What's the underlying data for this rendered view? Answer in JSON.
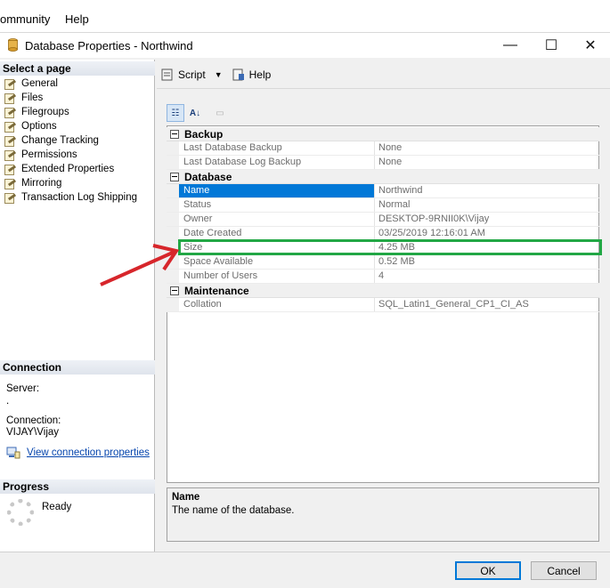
{
  "menubar": {
    "items": [
      "ommunity",
      "Help"
    ]
  },
  "window": {
    "title": "Database Properties - Northwind",
    "min": "—",
    "max": "☐",
    "close": "✕"
  },
  "leftpane": {
    "select_page_header": "Select a page",
    "pages": [
      "General",
      "Files",
      "Filegroups",
      "Options",
      "Change Tracking",
      "Permissions",
      "Extended Properties",
      "Mirroring",
      "Transaction Log Shipping"
    ],
    "connection_header": "Connection",
    "server_label": "Server:",
    "server_value": ".",
    "connection_label": "Connection:",
    "connection_value": "VIJAY\\Vijay",
    "view_connection_link": "View connection properties",
    "progress_header": "Progress",
    "progress_status": "Ready"
  },
  "toolbar": {
    "script_label": "Script",
    "help_label": "Help"
  },
  "grid": {
    "categories": [
      {
        "name": "Backup",
        "rows": [
          {
            "name": "Last Database Backup",
            "value": "None"
          },
          {
            "name": "Last Database Log Backup",
            "value": "None"
          }
        ]
      },
      {
        "name": "Database",
        "rows": [
          {
            "name": "Name",
            "value": "Northwind"
          },
          {
            "name": "Status",
            "value": "Normal"
          },
          {
            "name": "Owner",
            "value": "DESKTOP-9RNII0K\\Vijay"
          },
          {
            "name": "Date Created",
            "value": "03/25/2019 12:16:01 AM"
          },
          {
            "name": "Size",
            "value": "4.25 MB"
          },
          {
            "name": "Space Available",
            "value": "0.52 MB"
          },
          {
            "name": "Number of Users",
            "value": "4"
          }
        ]
      },
      {
        "name": "Maintenance",
        "rows": [
          {
            "name": "Collation",
            "value": "SQL_Latin1_General_CP1_CI_AS"
          }
        ]
      }
    ]
  },
  "description": {
    "title": "Name",
    "text": "The name of the database."
  },
  "buttons": {
    "ok": "OK",
    "cancel": "Cancel"
  },
  "colors": {
    "highlight": "#22a745",
    "arrow": "#d7262b",
    "selection": "#0078d7"
  }
}
